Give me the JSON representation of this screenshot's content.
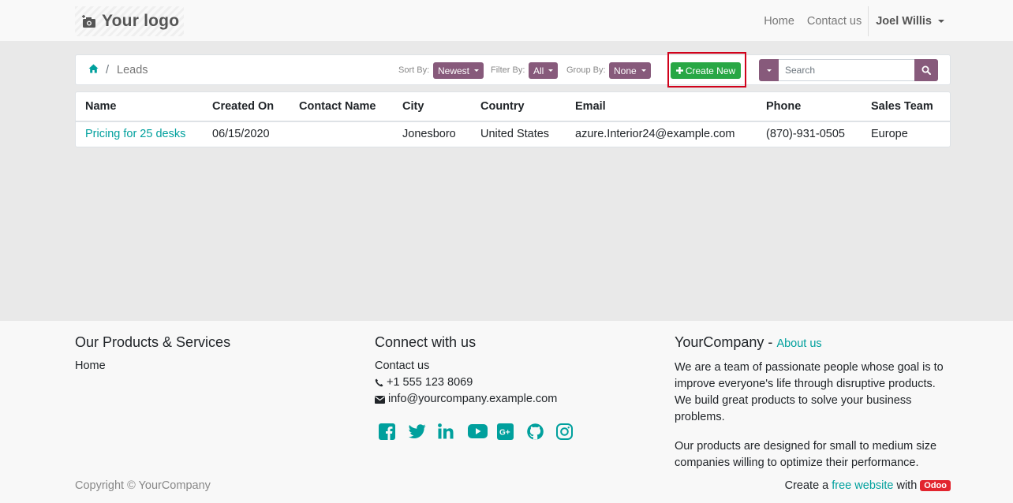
{
  "header": {
    "logo_text": "Your logo",
    "nav": [
      "Home",
      "Contact us"
    ],
    "user": "Joel Willis"
  },
  "toolbar": {
    "breadcrumb_current": "Leads",
    "breadcrumb_sep": "/",
    "sort_label": "Sort By:",
    "sort_value": "Newest",
    "filter_label": "Filter By:",
    "filter_value": "All",
    "group_label": "Group By:",
    "group_value": "None",
    "create_label": "Create New",
    "search_placeholder": "Search"
  },
  "table": {
    "headers": [
      "Name",
      "Created On",
      "Contact Name",
      "City",
      "Country",
      "Email",
      "Phone",
      "Sales Team"
    ],
    "rows": [
      {
        "name": "Pricing for 25 desks",
        "created_on": "06/15/2020",
        "contact_name": "",
        "city": "Jonesboro",
        "country": "United States",
        "email": "azure.Interior24@example.com",
        "phone": "(870)-931-0505",
        "sales_team": "Europe"
      }
    ]
  },
  "footer": {
    "products_title": "Our Products & Services",
    "products_link": "Home",
    "connect_title": "Connect with us",
    "connect_link": "Contact us",
    "phone": "+1 555 123 8069",
    "email": "info@yourcompany.example.com",
    "social_icons": [
      "facebook-icon",
      "twitter-icon",
      "linkedin-icon",
      "youtube-icon",
      "google-plus-icon",
      "github-icon",
      "instagram-icon"
    ],
    "company_name": "YourCompany",
    "company_sep": "-",
    "about_link": "About us",
    "about_p1": "We are a team of passionate people whose goal is to improve everyone's life through disruptive products. We build great products to solve your business problems.",
    "about_p2": "Our products are designed for small to medium size companies willing to optimize their performance.",
    "copyright": "Copyright © YourCompany",
    "powered_prefix": "Create a",
    "powered_link": "free website",
    "powered_mid": "with",
    "powered_badge": "Odoo"
  },
  "colors": {
    "accent": "#875a7b",
    "link": "#00a09d",
    "create": "#28a745",
    "highlight": "#d0021b"
  }
}
